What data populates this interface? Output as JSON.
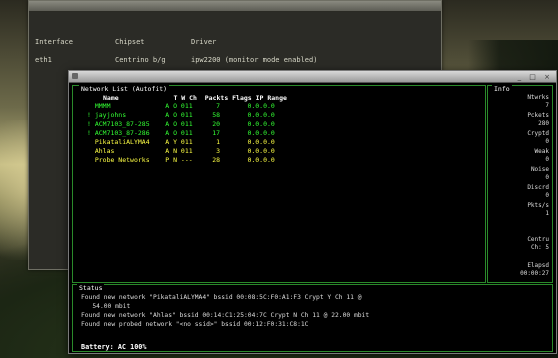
{
  "back_terminal": {
    "headers": [
      "Interface",
      "Chipset",
      "Driver"
    ],
    "row": [
      "eth1",
      "Centrino b/g",
      "ipw2200 (monitor mode enabled)"
    ]
  },
  "window": {
    "title": "",
    "buttons": "_ □ ×"
  },
  "network_panel": {
    "title": "Network List (Autofit)",
    "columns": "Name              T W Ch  Packts Flags IP Range",
    "rows": [
      {
        "prefix": " ",
        "name": "MMMM",
        "t": "A",
        "w": "O",
        "ch": "011",
        "packets": "7",
        "flags": "",
        "ip": "0.0.0.0",
        "color": "#33ff33"
      },
      {
        "prefix": "!",
        "name": "jayjohns",
        "t": "A",
        "w": "O",
        "ch": "011",
        "packets": "58",
        "flags": "",
        "ip": "0.0.0.0",
        "color": "#33ff33"
      },
      {
        "prefix": "!",
        "name": "ACM7103_87-285",
        "t": "A",
        "w": "O",
        "ch": "011",
        "packets": "20",
        "flags": "",
        "ip": "0.0.0.0",
        "color": "#33ff33"
      },
      {
        "prefix": "!",
        "name": "ACM7103_87-286",
        "t": "A",
        "w": "O",
        "ch": "011",
        "packets": "17",
        "flags": "",
        "ip": "0.0.0.0",
        "color": "#33ff33"
      },
      {
        "prefix": " ",
        "name": "PikataliALYMA4",
        "t": "A",
        "w": "Y",
        "ch": "011",
        "packets": "1",
        "flags": "",
        "ip": "0.0.0.0",
        "color": "#ffff44"
      },
      {
        "prefix": " ",
        "name": "Ahlas",
        "t": "A",
        "w": "N",
        "ch": "011",
        "packets": "3",
        "flags": "",
        "ip": "0.0.0.0",
        "color": "#ffff44"
      },
      {
        "prefix": " ",
        "name": "Probe Networks",
        "t": "P",
        "w": "N",
        "ch": "---",
        "packets": "28",
        "flags": "",
        "ip": "0.0.0.0",
        "color": "#ffff44"
      }
    ]
  },
  "info_panel": {
    "title": "Info",
    "items": [
      {
        "label": "Ntwrks",
        "value": "7"
      },
      {
        "label": "Pckets",
        "value": "280"
      },
      {
        "label": "Cryptd",
        "value": "0"
      },
      {
        "label": "Weak",
        "value": "0"
      },
      {
        "label": "Noise",
        "value": "0"
      },
      {
        "label": "Discrd",
        "value": "0"
      },
      {
        "label": "Pkts/s",
        "value": "1"
      }
    ],
    "channel_label": "Centru",
    "channel_value": "Ch: 5",
    "elapsed_label": "Elapsd",
    "elapsed_value": "00:00:27"
  },
  "status_panel": {
    "title": "Status",
    "lines": [
      "Found new network \"PikataliALYMA4\" bssid 00:08:5C:F0:A1:F3 Crypt Y Ch 11 @",
      "   54.00 mbit",
      "Found new network \"Ahlas\" bssid 00:14:C1:25:04:7C Crypt N Ch 11 @ 22.00 mbit",
      "Found new probed network \"<no ssid>\" bssid 00:12:F0:31:C8:1C"
    ],
    "battery": "Battery: AC 100%"
  }
}
